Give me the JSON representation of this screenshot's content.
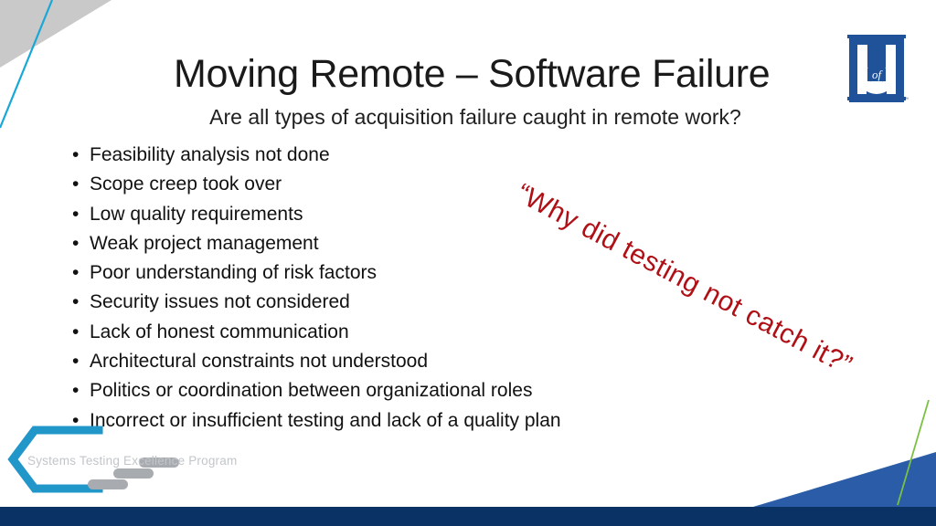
{
  "slide": {
    "title": "Moving Remote – Software Failure",
    "subtitle": "Are all types of acquisition failure caught in remote work?",
    "bullet_marker": "•",
    "bullets": [
      "Feasibility analysis not done",
      "Scope creep took over",
      "Low quality requirements",
      "Weak project management",
      "Poor understanding of risk factors",
      "Security issues not considered",
      "Lack of honest communication",
      "Architectural constraints not understood",
      "Politics or coordination between organizational roles",
      "Incorrect or insufficient testing and lack of a quality plan"
    ],
    "callout": "“Why did testing not catch it?”"
  },
  "logos": {
    "university": {
      "letter_top": "U",
      "letter_mid": "of",
      "letter_bottom": "M",
      "trademark": "™"
    },
    "step": {
      "name": "Systems Testing Excellence Program"
    }
  },
  "colors": {
    "callout_red": "#af1016",
    "um_blue": "#1f5299",
    "step_blue": "#2196c9",
    "step_gray": "#a8acb0",
    "step_text_gray": "#c2c6c9",
    "navy_bar": "#0b3265",
    "mid_blue_triangle": "#2a5ca8",
    "top_gray_triangle": "#c9c9c9",
    "cyan_line": "#18a8d8",
    "green_line": "#7ac143",
    "text_dark": "#111111"
  }
}
